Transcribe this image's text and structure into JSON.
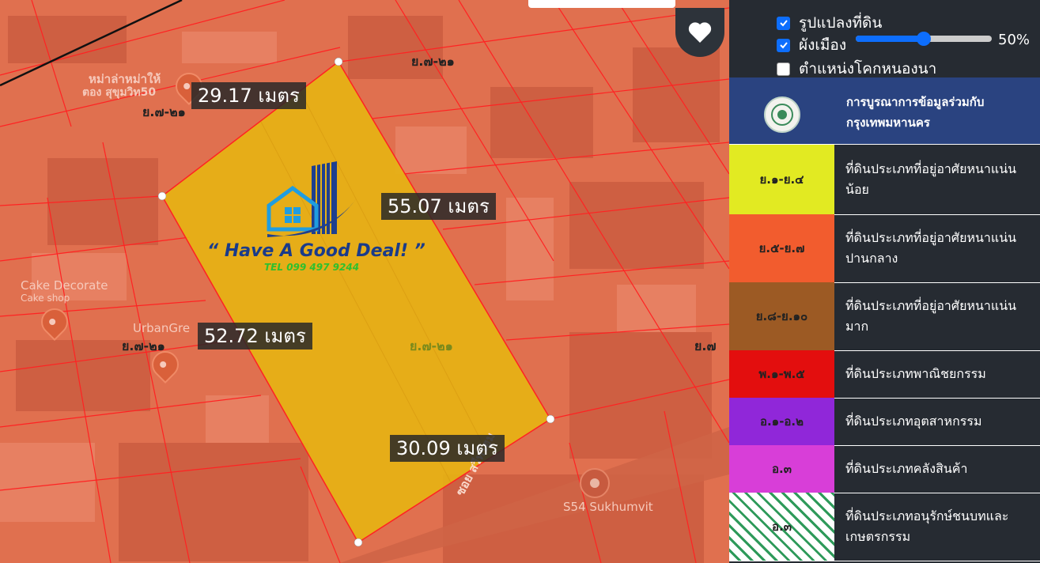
{
  "map": {
    "measurements": {
      "top": "29.17 เมตร",
      "right": "55.07 เมตร",
      "left": "52.72 เมตร",
      "bottom": "30.09 เมตร"
    },
    "zone_labels": {
      "top_right": "ย.๗-๒๑",
      "top_left": "ย.๗-๒๑",
      "left": "ย.๗-๒๑",
      "center": "ย.๗-๒๑",
      "right_edge": "ย.๗"
    },
    "pois": {
      "restaurant_line1": "หม่าล่าหม่าให้",
      "restaurant_line2": "ตอง สุขุมวิท50",
      "cake_name": "Cake Decorate",
      "cake_type": "Cake shop",
      "urban_name": "UrbanGre",
      "store_name": "S54 Sukhumvit",
      "road_name": "ซอย สวีทโฮม"
    },
    "watermark": {
      "slogan": "“ Have A Good Deal! ”",
      "tel": "TEL 099 497 9244"
    },
    "heart_icon": "heart-icon",
    "colors": {
      "zone_fill": "#e0704f",
      "parcel_fill": "#e6b214",
      "parcel_line": "#ff2222"
    }
  },
  "panel": {
    "layers": [
      {
        "label": "รูปแปลงที่ดิน",
        "checked": true
      },
      {
        "label": "ผังเมือง",
        "checked": true
      },
      {
        "label": "ตำแหน่งโคกหนองนา",
        "checked": false
      }
    ],
    "opacity": {
      "value": 50,
      "label": "50%"
    },
    "bkk_text": "การบูรณาการข้อมูลร่วมกับกรุงเทพมหานคร",
    "legend": [
      {
        "code": "ย.๑-ย.๔",
        "desc": "ที่ดินประเภทที่อยู่อาศัยหนาแน่นน้อย",
        "color": "#e2ea22"
      },
      {
        "code": "ย.๕-ย.๗",
        "desc": "ที่ดินประเภทที่อยู่อาศัยหนาแน่นปานกลาง",
        "color": "#f25c2e"
      },
      {
        "code": "ย.๘-ย.๑๐",
        "desc": "ที่ดินประเภทที่อยู่อาศัยหนาแน่นมาก",
        "color": "#9c5a24"
      },
      {
        "code": "พ.๑-พ.๕",
        "desc": "ที่ดินประเภทพาณิชยกรรม",
        "color": "#e30e0e"
      },
      {
        "code": "อ.๑-อ.๒",
        "desc": "ที่ดินประเภทอุตสาหกรรม",
        "color": "#9027d9"
      },
      {
        "code": "อ.๓",
        "desc": "ที่ดินประเภทคลังสินค้า",
        "color": "#d83ed8"
      },
      {
        "code": "อ.๓",
        "desc": "ที่ดินประเภทอนุรักษ์ชนบทและเกษตรกรรม",
        "color": "#ffffff"
      }
    ],
    "fab_icon": "more-dots-icon"
  }
}
